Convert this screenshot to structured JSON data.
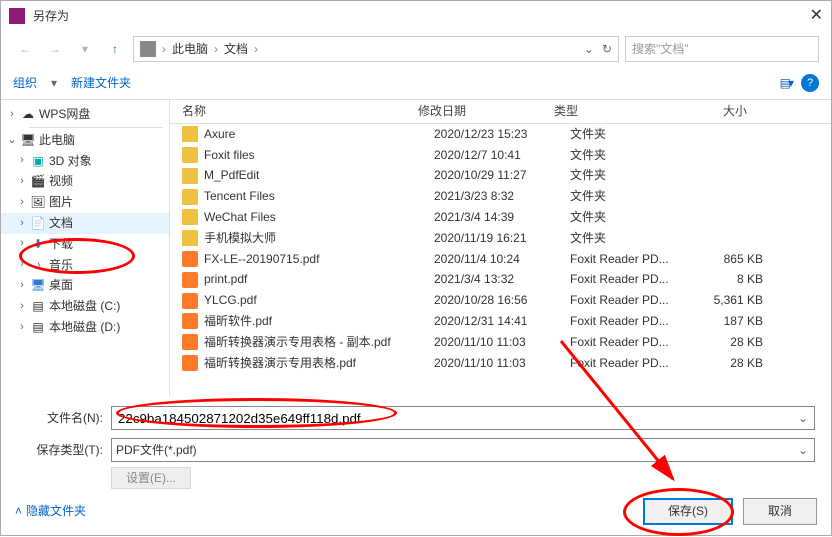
{
  "titlebar": {
    "title": "另存为"
  },
  "breadcrumb": {
    "root": "此电脑",
    "folder": "文档"
  },
  "search": {
    "placeholder": "搜索\"文档\""
  },
  "toolbar": {
    "organize": "组织",
    "new_folder": "新建文件夹"
  },
  "tree": {
    "wps": "WPS网盘",
    "this_pc": "此电脑",
    "objects3d": "3D 对象",
    "videos": "视频",
    "pictures": "图片",
    "documents": "文档",
    "downloads": "下载",
    "music": "音乐",
    "desktop": "桌面",
    "disk_c": "本地磁盘 (C:)",
    "disk_d": "本地磁盘 (D:)"
  },
  "columns": {
    "name": "名称",
    "date": "修改日期",
    "type": "类型",
    "size": "大小"
  },
  "files": [
    {
      "name": "Axure",
      "date": "2020/12/23 15:23",
      "type": "文件夹",
      "size": "",
      "kind": "folder"
    },
    {
      "name": "Foxit files",
      "date": "2020/12/7 10:41",
      "type": "文件夹",
      "size": "",
      "kind": "folder"
    },
    {
      "name": "M_PdfEdit",
      "date": "2020/10/29 11:27",
      "type": "文件夹",
      "size": "",
      "kind": "folder"
    },
    {
      "name": "Tencent Files",
      "date": "2021/3/23 8:32",
      "type": "文件夹",
      "size": "",
      "kind": "folder"
    },
    {
      "name": "WeChat Files",
      "date": "2021/3/4 14:39",
      "type": "文件夹",
      "size": "",
      "kind": "folder"
    },
    {
      "name": "手机模拟大师",
      "date": "2020/11/19 16:21",
      "type": "文件夹",
      "size": "",
      "kind": "folder"
    },
    {
      "name": "FX-LE--20190715.pdf",
      "date": "2020/11/4 10:24",
      "type": "Foxit Reader PD...",
      "size": "865 KB",
      "kind": "pdf"
    },
    {
      "name": "print.pdf",
      "date": "2021/3/4 13:32",
      "type": "Foxit Reader PD...",
      "size": "8 KB",
      "kind": "pdf"
    },
    {
      "name": "YLCG.pdf",
      "date": "2020/10/28 16:56",
      "type": "Foxit Reader PD...",
      "size": "5,361 KB",
      "kind": "pdf"
    },
    {
      "name": "福昕软件.pdf",
      "date": "2020/12/31 14:41",
      "type": "Foxit Reader PD...",
      "size": "187 KB",
      "kind": "pdf"
    },
    {
      "name": "福昕转换器演示专用表格 - 副本.pdf",
      "date": "2020/11/10 11:03",
      "type": "Foxit Reader PD...",
      "size": "28 KB",
      "kind": "pdf"
    },
    {
      "name": "福昕转换器演示专用表格.pdf",
      "date": "2020/11/10 11:03",
      "type": "Foxit Reader PD...",
      "size": "28 KB",
      "kind": "pdf"
    }
  ],
  "form": {
    "filename_label": "文件名(N):",
    "filename_value": "22c9ba184502871202d35e649ff118d.pdf",
    "type_label": "保存类型(T):",
    "type_value": "PDF文件(*.pdf)",
    "settings": "设置(E)..."
  },
  "footer": {
    "hide_folders": "隐藏文件夹",
    "save": "保存(S)",
    "cancel": "取消"
  }
}
